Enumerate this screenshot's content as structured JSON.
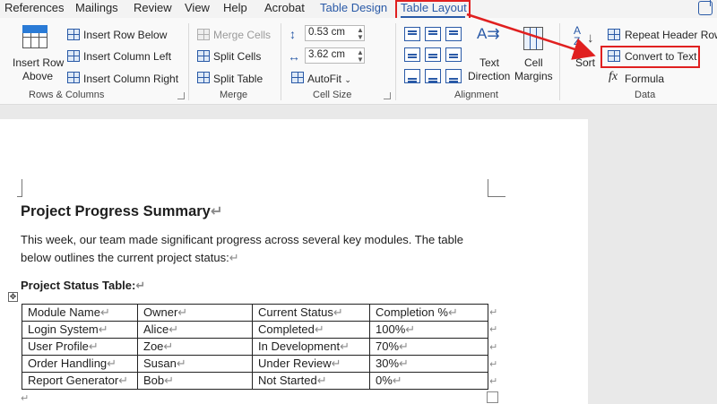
{
  "tabs": {
    "references": "References",
    "mailings": "Mailings",
    "review": "Review",
    "view": "View",
    "help": "Help",
    "acrobat": "Acrobat",
    "table_design": "Table Design",
    "table_layout": "Table Layout"
  },
  "ribbon": {
    "rows_columns": {
      "insert_above_line1": "Insert Row",
      "insert_above_line2": "Above",
      "insert_below": "Insert Row Below",
      "insert_left": "Insert Column Left",
      "insert_right": "Insert Column Right",
      "group_label": "Rows & Columns"
    },
    "merge": {
      "merge_cells": "Merge Cells",
      "split_cells": "Split Cells",
      "split_table": "Split Table",
      "group_label": "Merge"
    },
    "cell_size": {
      "height_value": "0.53 cm",
      "width_value": "3.62 cm",
      "autofit": "AutoFit",
      "group_label": "Cell Size"
    },
    "alignment": {
      "text_direction_line1": "Text",
      "text_direction_line2": "Direction",
      "cell_margins_line1": "Cell",
      "cell_margins_line2": "Margins",
      "group_label": "Alignment"
    },
    "data": {
      "sort": "Sort",
      "repeat_header_rows": "Repeat Header Rows",
      "convert_to_text": "Convert to Text",
      "formula": "Formula",
      "group_label": "Data"
    }
  },
  "document": {
    "title": "Project Progress Summary",
    "intro_line1": "This week, our team made significant progress across several key modules. The table",
    "intro_line2": "below outlines the current project status:",
    "table_caption": "Project Status Table:",
    "paragraph_mark": "↵",
    "table": {
      "header": [
        "Module Name",
        "Owner",
        "Current Status",
        "Completion %"
      ],
      "rows": [
        [
          "Login System",
          "Alice",
          "Completed",
          "100%"
        ],
        [
          "User Profile",
          "Zoe",
          "In Development",
          "70%"
        ],
        [
          "Order Handling",
          "Susan",
          "Under Review",
          "30%"
        ],
        [
          "Report Generator",
          "Bob",
          "Not Started",
          "0%"
        ]
      ]
    }
  },
  "colors": {
    "accent": "#2a5aa7",
    "highlight": "#e02020"
  }
}
